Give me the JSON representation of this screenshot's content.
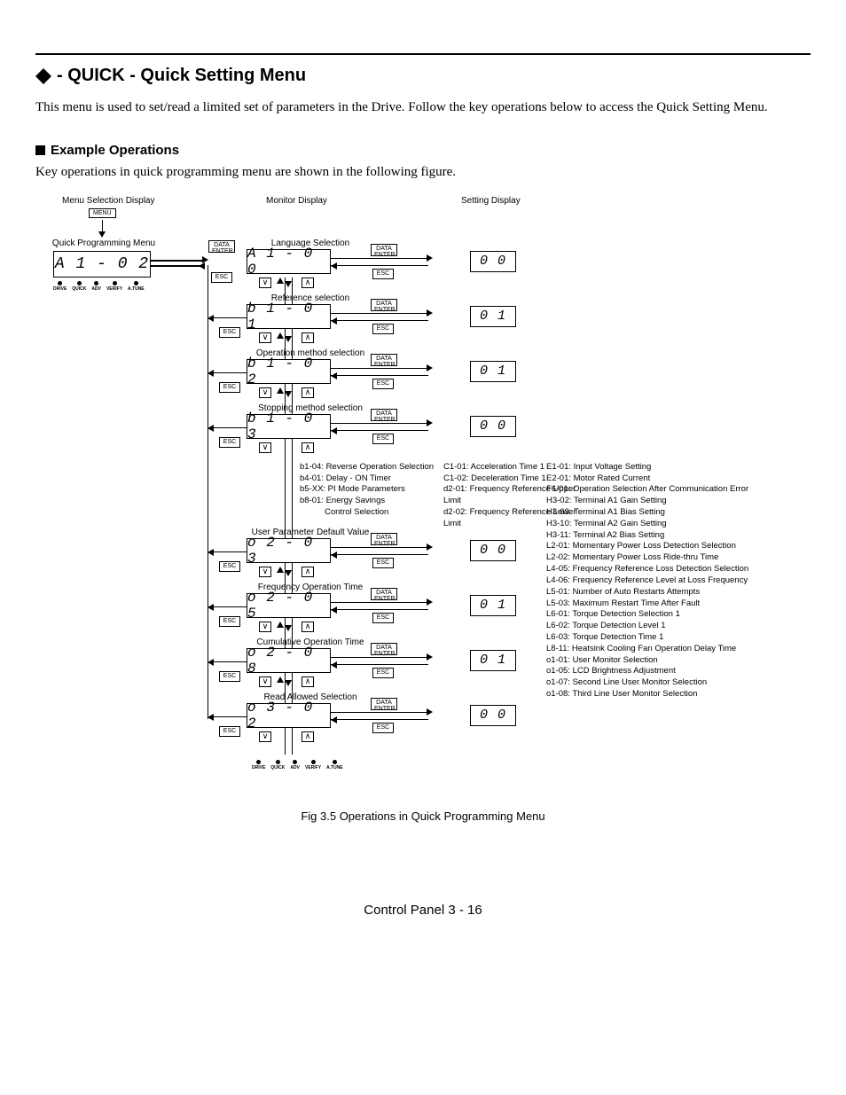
{
  "page": {
    "section_title": " - QUICK -  Quick Setting Menu",
    "intro": "This menu is used to set/read a limited set of parameters in the Drive. Follow the key operations below to access the Quick Setting Menu.",
    "subheading": "Example Operations",
    "lead": "Key operations in quick programming menu are shown in the following figure.",
    "figure_caption": "Fig 3.5  Operations in Quick Programming Menu",
    "footer": "Control Panel  3 - 16"
  },
  "headers": {
    "menu_sel": "Menu Selection Display",
    "monitor": "Monitor Display",
    "setting": "Setting Display",
    "quick_prog": "Quick Programming Menu"
  },
  "buttons": {
    "menu": "MENU",
    "data_enter": "DATA\nENTER",
    "esc": "ESC",
    "down": "∨",
    "up": "∧"
  },
  "leds": [
    "DRIVE",
    "QUICK",
    "ADV",
    "VERIFY",
    "A.TUNE"
  ],
  "left_display": "A 1 - 0 2",
  "monitor_rows": [
    {
      "label": "Language Selection",
      "value": "A 1 - 0 0",
      "result": "0 0"
    },
    {
      "label": "Reference selection",
      "value": "b 1 - 0 1",
      "result": "0 1"
    },
    {
      "label": "Operation method selection",
      "value": "b 1 - 0 2",
      "result": "0 1"
    },
    {
      "label": "Stopping method selection",
      "value": "b 1 - 0 3",
      "result": "0 0"
    },
    {
      "label": "User Parameter Default Value",
      "value": "o 2 - 0 3",
      "result": "0 0"
    },
    {
      "label": "Frequency Operation Time",
      "value": "o 2 - 0 5",
      "result": "0 1"
    },
    {
      "label": "Cumulative Operation Time",
      "value": "o 2 - 0 8",
      "result": "0 1"
    },
    {
      "label": "Read Allowed Selection",
      "value": "o 3 - 0 2",
      "result": "0 0"
    }
  ],
  "mid_params_col1": [
    "b1-04: Reverse Operation Selection",
    "b4-01: Delay - ON Timer",
    "b5-XX: PI Mode Parameters",
    "b8-01: Energy Savings",
    "Control Selection"
  ],
  "mid_params_col2": [
    "C1-01: Acceleration Time 1",
    "C1-02: Deceleration Time 1",
    "d2-01: Frequency Reference Upper Limit",
    "d2-02: Frequency Reference Lower Limit"
  ],
  "right_params": [
    "E1-01: Input Voltage Setting",
    "E2-01: Motor Rated Current",
    "F6-01: Operation Selection After Communication Error",
    "H3-02: Terminal A1 Gain Setting",
    "H3-03: Terminal A1 Bias Setting",
    "H3-10: Terminal A2 Gain Setting",
    "H3-11: Terminal A2 Bias Setting",
    "L2-01: Momentary Power Loss Detection Selection",
    "L2-02: Momentary Power Loss Ride-thru Time",
    "L4-05: Frequency Reference Loss Detection Selection",
    "L4-06: Frequency Reference Level at Loss Frequency",
    "L5-01: Number of Auto Restarts Attempts",
    "L5-03: Maximum Restart Time After Fault",
    "L6-01: Torque Detection Selection 1",
    "L6-02: Torque Detection Level 1",
    "L6-03: Torque Detection Time 1",
    "L8-11: Heatsink Cooling Fan Operation Delay Time",
    "o1-01: User Monitor Selection",
    "o1-05: LCD Brightness Adjustment",
    "o1-07: Second Line User Monitor Selection",
    "o1-08: Third Line User Monitor Selection"
  ]
}
